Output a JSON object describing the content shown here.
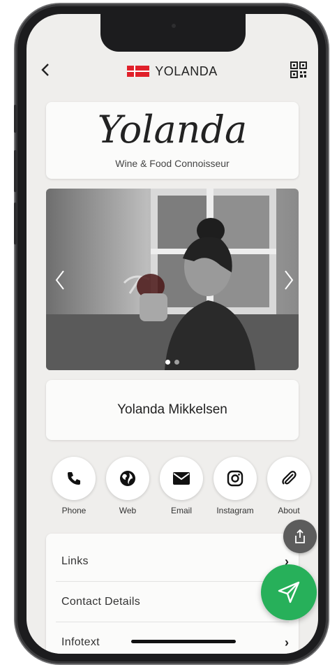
{
  "header": {
    "title": "YOLANDA",
    "back_icon": "chevron-left-icon",
    "qr_icon": "qr-code-icon",
    "flag": "danish-flag"
  },
  "logo": {
    "script": "Yolanda",
    "subtitle": "Wine & Food Connoisseur"
  },
  "carousel": {
    "slide_count": 2,
    "active_index": 0
  },
  "profile": {
    "name": "Yolanda Mikkelsen"
  },
  "actions": [
    {
      "label": "Phone",
      "icon": "phone-icon"
    },
    {
      "label": "Web",
      "icon": "globe-icon"
    },
    {
      "label": "Email",
      "icon": "envelope-icon"
    },
    {
      "label": "Instagram",
      "icon": "instagram-icon"
    },
    {
      "label": "About",
      "icon": "paperclip-icon"
    }
  ],
  "list": [
    {
      "label": "Links"
    },
    {
      "label": "Contact Details"
    },
    {
      "label": "Infotext"
    }
  ],
  "colors": {
    "accent_green": "#27b05a",
    "flag_red": "#e0202a",
    "share_grey": "#5c5c5c"
  }
}
